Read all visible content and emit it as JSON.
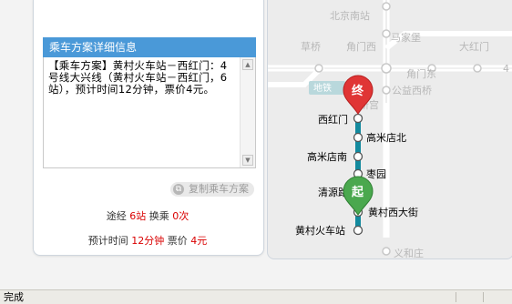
{
  "panel": {
    "header": "乘车方案详细信息",
    "plan_text": "【乘车方案】黄村火车站－西红门：4号线大兴线（黄村火车站－西红门，6站），预计时间12分钟，票价4元。",
    "copy_button": "复制乘车方案",
    "stats": {
      "via_label": "途经",
      "via_value": "6站",
      "transfer_label": "换乘",
      "transfer_value": "0次",
      "time_label": "预计时间",
      "time_value": "12分钟",
      "fare_label": "票价",
      "fare_value": "4元"
    }
  },
  "map": {
    "station_labels": {
      "beijing_south": "北京南站",
      "majiabao": "马家堡",
      "caoqiao": "草桥",
      "jiaomenxi": "角门西",
      "jiaomendong": "角门东",
      "dahongmen": "大红门",
      "digit_4": "4",
      "gongyixiqiao": "公益西桥",
      "xingong": "新宫",
      "xihongmen": "西红门",
      "gaomidian_north": "高米店北",
      "gaomidian_south": "高米店南",
      "zaoyuan": "枣园",
      "qingyuanlu": "清源路",
      "huangcunxidajie": "黄村西大街",
      "huangcun_station": "黄村火车站",
      "yiheizhuang": "义和庄",
      "line_badge": "地铁"
    },
    "end_marker": "终",
    "start_marker": "起",
    "colors": {
      "daxing_line": "#138a9e",
      "line4": "#1f9ea5",
      "end_pin": "#e03535",
      "start_pin": "#4aa84e"
    }
  },
  "status_bar": {
    "text": "完成"
  }
}
